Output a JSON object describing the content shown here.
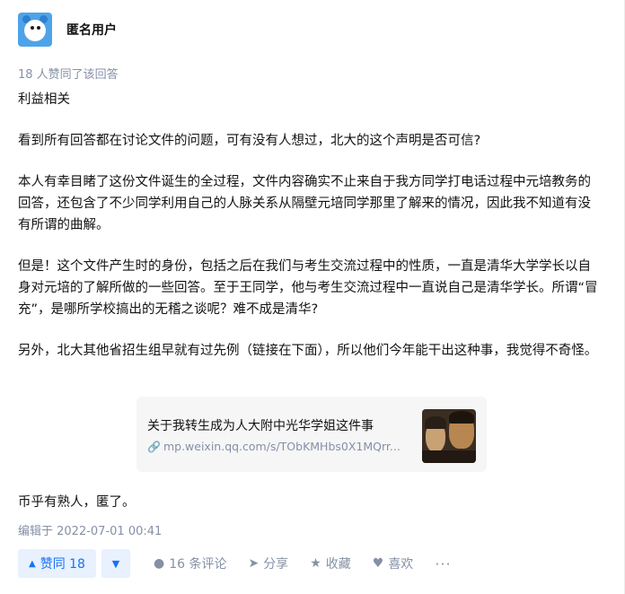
{
  "author": {
    "name": "匿名用户"
  },
  "votes_line": "18 人赞同了该回答",
  "content": {
    "paragraphs": [
      "利益相关",
      "看到所有回答都在讨论文件的问题，可有没有人想过，北大的这个声明是否可信?",
      "本人有幸目睹了这份文件诞生的全过程，文件内容确实不止来自于我方同学打电话过程中元培教务的回答，还包含了不少同学利用自己的人脉关系从隔壁元培同学那里了解来的情况，因此我不知道有没有所谓的曲解。",
      "但是！这个文件产生时的身份，包括之后在我们与考生交流过程中的性质，一直是清华大学学长以自身对元培的了解所做的一些回答。至于王同学，他与考生交流过程中一直说自己是清华学长。所谓“冒充”，是哪所学校搞出的无稽之谈呢？难不成是清华?",
      "另外，北大其他省招生组早就有过先例（链接在下面），所以他们今年能干出这种事，我觉得不奇怪。"
    ],
    "last_line": "币乎有熟人，匿了。"
  },
  "link_card": {
    "title": "关于我转生成为人大附中光华学姐这件事",
    "url": "mp.weixin.qq.com/s/TObKMHbs0X1MQrr...",
    "link_icon": "link-icon",
    "thumbnail": "thumbnail-image"
  },
  "edited": "编辑于 2022-07-01 00:41",
  "actions": {
    "upvote_label": "赞同 18",
    "comment_label": "16 条评论",
    "share_label": "分享",
    "favorite_label": "收藏",
    "like_label": "喜欢",
    "more_label": "···"
  },
  "colors": {
    "accent": "#1772f6",
    "vote_bg": "#e8f1fd",
    "meta_gray": "#8590a6",
    "avatar_blue": "#4ea3e8"
  }
}
